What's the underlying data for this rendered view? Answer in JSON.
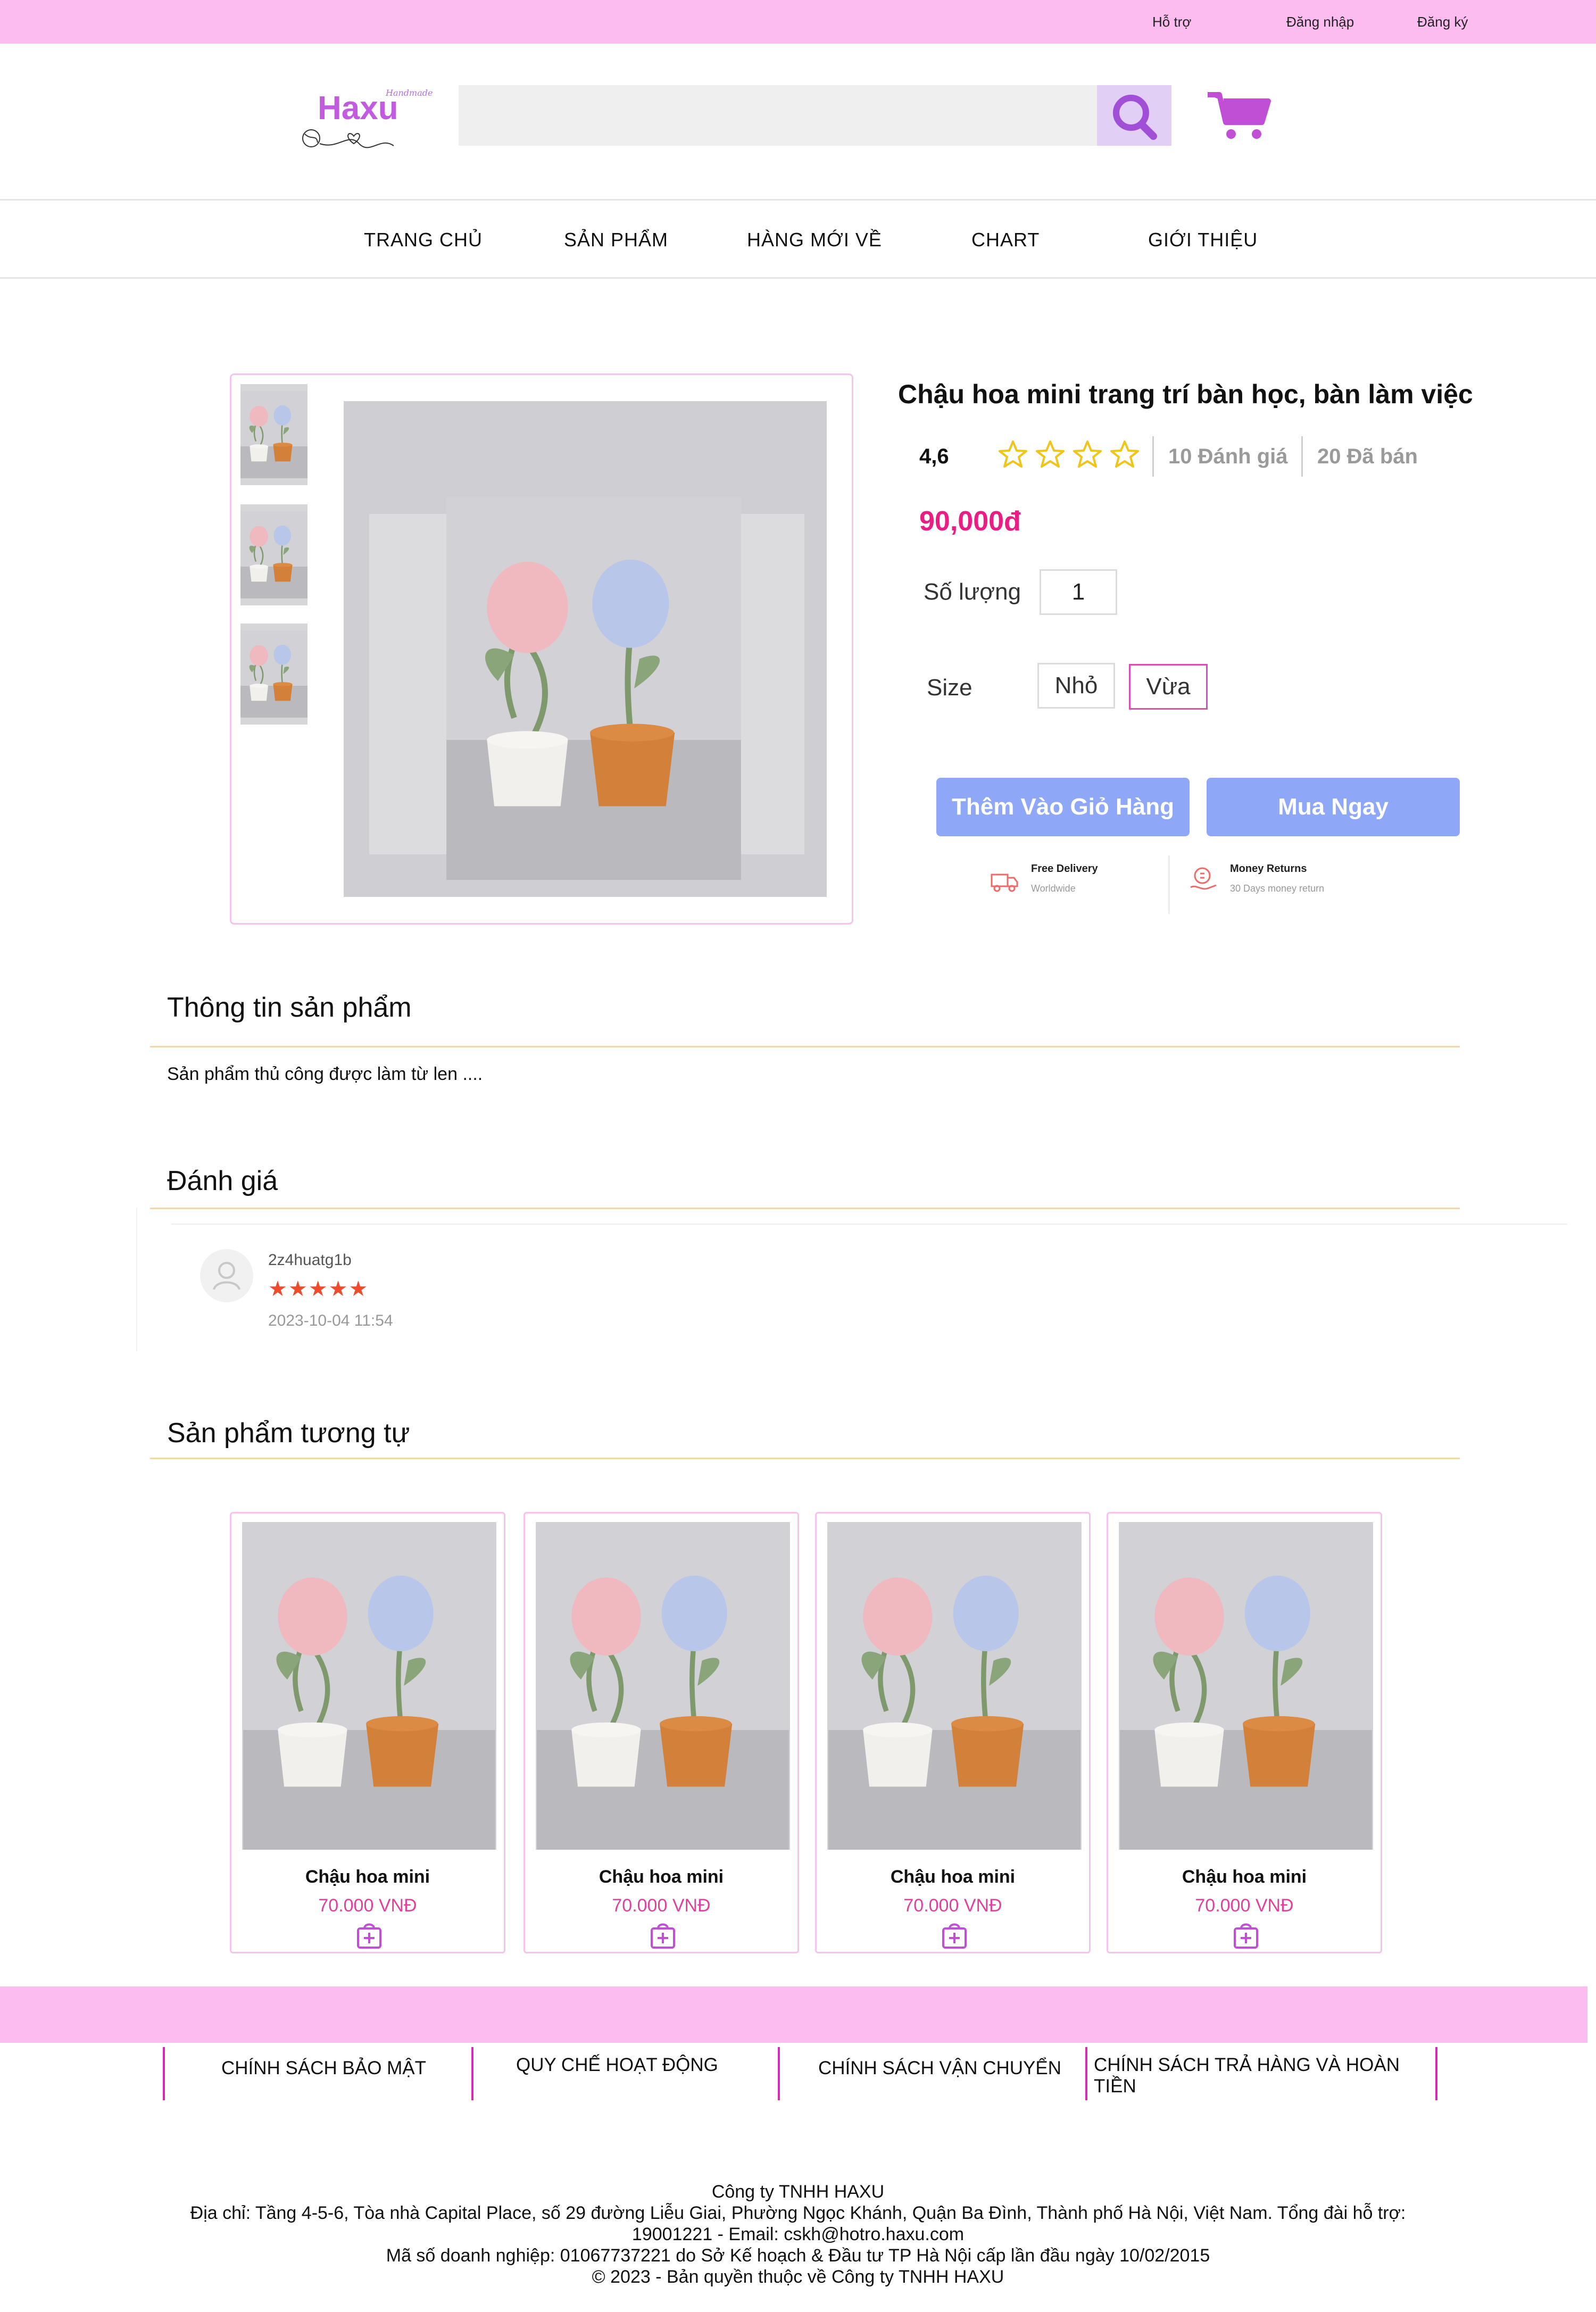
{
  "topbar": {
    "support": "Hỗ trợ",
    "login": "Đăng nhập",
    "register": "Đăng ký"
  },
  "header": {
    "logo_text": "Haxu",
    "logo_tagline": "Handmade",
    "search_placeholder": ""
  },
  "nav": {
    "items": [
      "TRANG CHỦ",
      "SẢN PHẨM",
      "HÀNG MỚI VỀ",
      "CHART",
      "GIỚI THIỆU"
    ]
  },
  "product": {
    "title": "Chậu hoa mini trang trí bàn học, bàn làm việc",
    "rating": "4,6",
    "stars_filled": 0,
    "stars_total": 5,
    "reviews": "10 Đánh giá",
    "sold": "20 Đã bán",
    "price": "90,000đ",
    "qty_label": "Số lượng",
    "qty_value": "1",
    "size_label": "Size",
    "sizes": [
      "Nhỏ",
      "Vừa"
    ],
    "selected_size": "Vừa",
    "add_to_cart": "Thêm Vào Giỏ Hàng",
    "buy_now": "Mua Ngay",
    "perks": [
      {
        "title": "Free Delivery",
        "subtitle": "Worldwide",
        "icon": "truck-icon"
      },
      {
        "title": "Money Returns",
        "subtitle": "30 Days money return",
        "icon": "money-return-icon"
      }
    ]
  },
  "info": {
    "title": "Thông tin sản phẩm",
    "description": "Sản phẩm thủ công được làm từ len ...."
  },
  "reviews_section": {
    "title": "Đánh giá",
    "items": [
      {
        "user": "2z4huatg1b",
        "stars": "★★★★★",
        "date": "2023-10-04 11:54"
      }
    ]
  },
  "similar": {
    "title": "Sản phẩm tương tự",
    "products": [
      {
        "name": "Chậu hoa mini",
        "price": "70.000 VNĐ"
      },
      {
        "name": "Chậu hoa mini",
        "price": "70.000 VNĐ"
      },
      {
        "name": "Chậu hoa mini",
        "price": "70.000 VNĐ"
      },
      {
        "name": "Chậu hoa mini",
        "price": "70.000 VNĐ"
      }
    ]
  },
  "footer": {
    "policies": [
      "CHÍNH SÁCH BẢO MẬT",
      "QUY CHẾ HOẠT ĐỘNG",
      "CHÍNH SÁCH VẬN CHUYỂN",
      "CHÍNH SÁCH TRẢ HÀNG VÀ HOÀN TIỀN"
    ],
    "company": "Công ty TNHH HAXU",
    "address": "Địa chỉ: Tầng 4-5-6, Tòa nhà Capital Place, số 29 đường Liễu Giai, Phường Ngọc Khánh, Quận Ba Đình, Thành phố Hà Nội, Việt Nam. Tổng đài hỗ trợ:",
    "contact": "19001221 - Email: cskh@hotro.haxu.com",
    "business_id": "Mã số doanh nghiệp: 01067737221 do Sở Kế hoạch & Đầu tư TP Hà Nội cấp lần đầu ngày 10/02/2015",
    "copyright": "© 2023 - Bản quyền thuộc về Công ty TNHH HAXU"
  },
  "colors": {
    "pink_band": "#fdbcf0",
    "price": "#ea1d83",
    "button": "#8ea7f7",
    "star_outline": "#f0c419",
    "review_star": "#ee4d2d"
  }
}
